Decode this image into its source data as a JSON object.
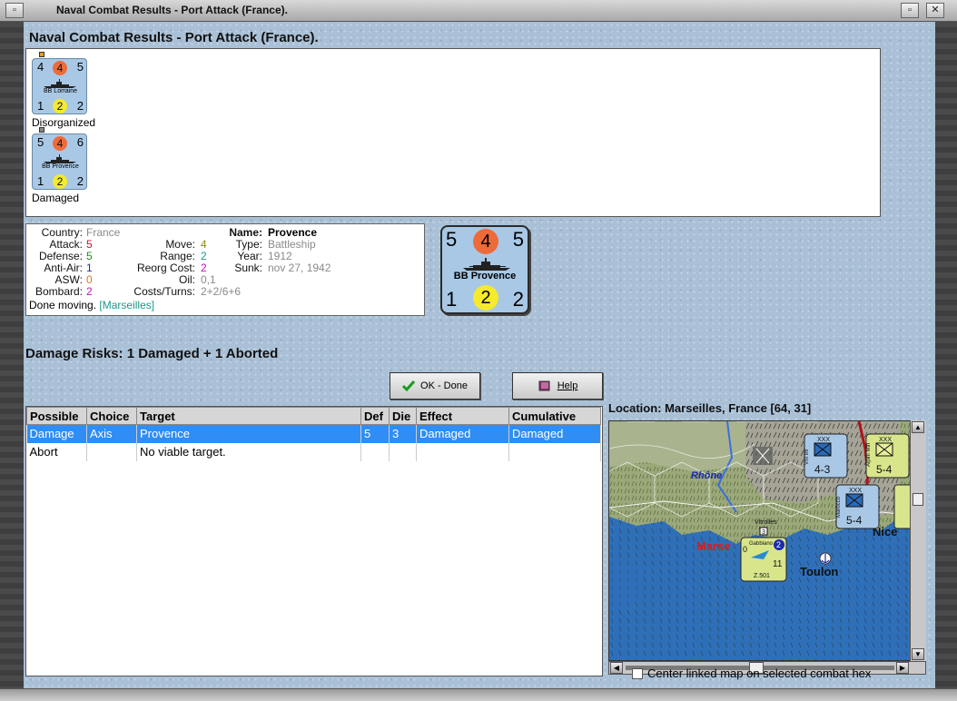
{
  "window": {
    "title": "Naval Combat Results - Port Attack (France)."
  },
  "heading": "Naval Combat Results - Port Attack (France).",
  "units": [
    {
      "attack": "4",
      "attack_circle": "4",
      "move": "5",
      "defense": "1",
      "defense_circle": "2",
      "range": "2",
      "name": "BB Lorraine",
      "status": "Disorganized"
    },
    {
      "attack": "5",
      "attack_circle": "4",
      "move": "6",
      "defense": "1",
      "defense_circle": "2",
      "range": "2",
      "name": "BB Provence",
      "status": "Damaged"
    }
  ],
  "info": {
    "country_label": "Country:",
    "country": "France",
    "attack_label": "Attack:",
    "attack": "5",
    "defense_label": "Defense:",
    "defense": "5",
    "antiair_label": "Anti-Air:",
    "antiair": "1",
    "asw_label": "ASW:",
    "asw": "0",
    "bombard_label": "Bombard:",
    "bombard": "2",
    "move_label": "Move:",
    "move": "4",
    "range_label": "Range:",
    "range": "2",
    "reorg_label": "Reorg Cost:",
    "reorg": "2",
    "oil_label": "Oil:",
    "oil": "0,1",
    "costs_label": "Costs/Turns:",
    "costs": "2+2/6+6",
    "name_label": "Name:",
    "name": "Provence",
    "type_label": "Type:",
    "type": "Battleship",
    "year_label": "Year:",
    "year": "1912",
    "sunk_label": "Sunk:",
    "sunk": "nov 27, 1942",
    "done_text": "Done moving.",
    "done_location": "[Marseilles]"
  },
  "big_counter": {
    "top_left": "5",
    "attack": "4",
    "top_right": "5",
    "name": "BB Provence",
    "bottom_left": "1",
    "defense": "2",
    "bottom_right": "2"
  },
  "damage_risks": "Damage Risks:  1 Damaged + 1 Aborted",
  "buttons": {
    "ok": "OK - Done",
    "help": "Help"
  },
  "table": {
    "headers": [
      "Possible",
      "Choice",
      "Target",
      "Def",
      "Die",
      "Effect",
      "Cumulative"
    ],
    "rows": [
      [
        "Damage",
        "Axis",
        "Provence",
        "5",
        "3",
        "Damaged",
        "Damaged"
      ],
      [
        "Abort",
        "",
        "No viable target.",
        "",
        "",
        "",
        ""
      ]
    ]
  },
  "location": "Location:  Marseilles, France [64, 31]",
  "map": {
    "labels": {
      "rhone": "Rhône",
      "marseilles": "Marse",
      "toulon": "Toulon",
      "nice": "Nice",
      "vitrolles": "Vitrolles",
      "nice_partial": "Nice"
    },
    "counters": [
      {
        "top": "XXX",
        "side": "VIII Inf",
        "value": "4-3"
      },
      {
        "top": "XXX",
        "side": "Alpini Mtn",
        "value": "5-4"
      },
      {
        "top": "XXX",
        "side": "Marocco",
        "value": "5-4"
      },
      {
        "top": "",
        "side": "Gabbiano",
        "value": "11",
        "small": "Z.501",
        "left": "0",
        "circle": "2"
      }
    ]
  },
  "checkbox_label": "Center linked map on selected combat hex",
  "colors": {
    "counter_blue": "#a8c8e6",
    "attack_circle": "#ef6a3a",
    "defense_circle": "#f5ea2c",
    "selection": "#2f8df3",
    "sea": "#3a7ac0"
  }
}
